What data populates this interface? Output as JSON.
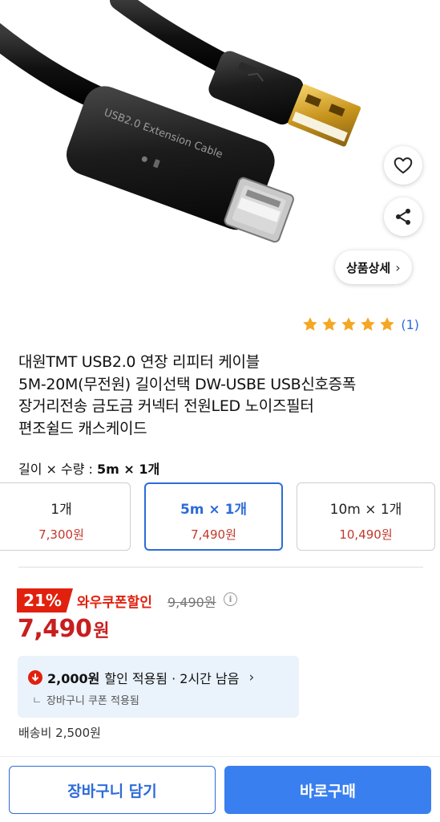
{
  "product_image": {
    "cable_print": "USB2.0 Extension Cable",
    "detail_button_label": "상품상세",
    "detail_button_chevron": "›",
    "favorite_icon": "heart-icon",
    "share_icon": "share-icon"
  },
  "rating": {
    "stars": 5,
    "count": "(1)",
    "star_color": "#f5a623"
  },
  "title": {
    "lines": [
      "대원TMT USB2.0 연장 리피터 케이블",
      "5M-20M(무전원) 길이선택 DW-USBE USB신호증폭",
      "장거리전송 금도금 커넥터 전원LED 노이즈필터",
      "편조쉴드 캐스케이드"
    ]
  },
  "options": {
    "label_prefix": "길이 × 수량 : ",
    "label_value": "5m × 1개",
    "items": [
      {
        "name": "1개",
        "price": "7,300원",
        "selected": false
      },
      {
        "name": "5m × 1개",
        "price": "7,490원",
        "selected": true
      },
      {
        "name": "10m × 1개",
        "price": "10,490원",
        "selected": false
      }
    ]
  },
  "price": {
    "discount_badge": "21%",
    "coupon_label": "와우쿠폰할인",
    "original_price": "9,490원",
    "info_icon": "i",
    "final_price": "7,490",
    "final_currency": "원",
    "sale_color": "#e2200e"
  },
  "coupon_box": {
    "amount": "2,000원",
    "text": "할인 적용됨 · 2시간 남음",
    "chevron": "›",
    "sub_text": "장바구니 쿠폰 적용됨",
    "sub_corner": "ㄴ"
  },
  "shipping": {
    "text": "배송비 2,500원"
  },
  "bottom_bar": {
    "cart_label": "장바구니 담기",
    "buy_label": "바로구매",
    "accent_color": "#3a7fef"
  }
}
